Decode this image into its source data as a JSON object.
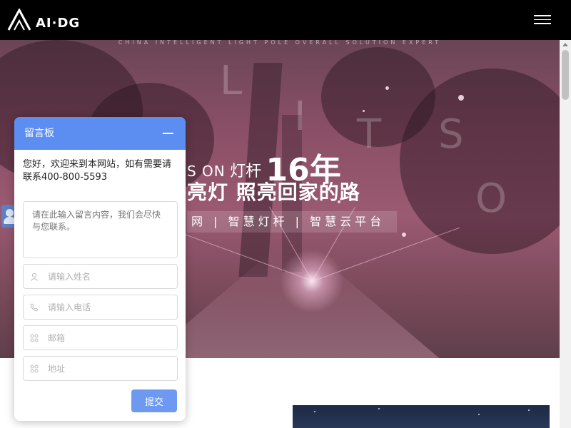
{
  "header": {
    "logo_text": "AI·DG",
    "menu_icon": "hamburger-menu-icon"
  },
  "hero": {
    "tagline": "CHINA INTELLIGENT LIGHT POLE OVERALL SOLUTION EXPERT",
    "line1_en": "S ON",
    "line1_cn": "灯杆",
    "line1_num": "16年",
    "line2": "亮灯 照亮回家的路",
    "line3": "网 | 智慧灯杆 | 智慧云平台",
    "letters": [
      "L",
      "I",
      "T",
      "S",
      "O"
    ]
  },
  "chat": {
    "title": "留言板",
    "minimize_icon": "minimize-icon",
    "notice": "您好，欢迎来到本网站，如有需要请联系400-800-5593",
    "message_placeholder": "请在此输入留言内容，我们会尽快与您联系。",
    "name_placeholder": "请输入姓名",
    "phone_placeholder": "请输入电话",
    "field3_placeholder": "邮箱",
    "field4_placeholder": "地址",
    "submit_label": "提交",
    "field_icons": [
      "user-icon",
      "phone-icon",
      "grid-icon",
      "grid-icon"
    ]
  },
  "side_avatar": {
    "icon": "customer-service-avatar-icon"
  }
}
